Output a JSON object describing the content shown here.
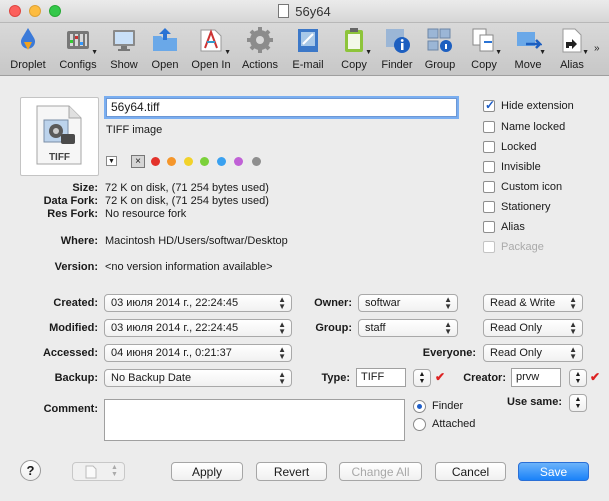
{
  "window": {
    "title": "56y64"
  },
  "toolbar": {
    "items": [
      {
        "label": "Droplet",
        "icon": "droplet-icon"
      },
      {
        "label": "Configs",
        "icon": "configs-icon"
      },
      {
        "label": "Show",
        "icon": "show-icon"
      },
      {
        "label": "Open",
        "icon": "open-icon"
      },
      {
        "label": "Open In",
        "icon": "open-in-icon"
      },
      {
        "label": "Actions",
        "icon": "gear-icon"
      },
      {
        "label": "E-mail",
        "icon": "email-icon"
      },
      {
        "label": "Copy",
        "icon": "clipboard-icon"
      },
      {
        "label": "Finder",
        "icon": "finder-info-icon"
      },
      {
        "label": "Group",
        "icon": "group-icon"
      },
      {
        "label": "Copy",
        "icon": "copy-files-icon"
      },
      {
        "label": "Move",
        "icon": "move-icon"
      },
      {
        "label": "Alias",
        "icon": "alias-icon"
      }
    ]
  },
  "file": {
    "name": "56y64.tiff",
    "kind": "TIFF image",
    "icon_label": "TIFF"
  },
  "labels": {
    "colors": [
      "#e3322b",
      "#f5962a",
      "#f2d22a",
      "#7bd13a",
      "#3aa1f0",
      "#c061d6",
      "#8f8f8f"
    ]
  },
  "info": {
    "size_label": "Size:",
    "size_value": "72 K on disk, (71 254 bytes used)",
    "datafork_label": "Data Fork:",
    "datafork_value": "72 K on disk, (71 254 bytes used)",
    "resfork_label": "Res Fork:",
    "resfork_value": "No resource fork",
    "where_label": "Where:",
    "where_value": "Macintosh HD/Users/softwar/Desktop",
    "version_label": "Version:",
    "version_value": "<no version information available>"
  },
  "options": {
    "hide_extension": {
      "label": "Hide extension",
      "checked": true
    },
    "name_locked": {
      "label": "Name locked",
      "checked": false
    },
    "locked": {
      "label": "Locked",
      "checked": false
    },
    "invisible": {
      "label": "Invisible",
      "checked": false
    },
    "custom_icon": {
      "label": "Custom icon",
      "checked": false
    },
    "stationery": {
      "label": "Stationery",
      "checked": false
    },
    "alias": {
      "label": "Alias",
      "checked": false
    },
    "package": {
      "label": "Package",
      "checked": false
    }
  },
  "dates": {
    "created_label": "Created:",
    "created_value": "03 июля 2014 г., 22:24:45",
    "modified_label": "Modified:",
    "modified_value": "03 июля 2014 г., 22:24:45",
    "accessed_label": "Accessed:",
    "accessed_value": "04 июня 2014 г., 0:21:37",
    "backup_label": "Backup:",
    "backup_value": "No Backup Date"
  },
  "perms": {
    "owner_label": "Owner:",
    "owner_value": "softwar",
    "owner_perm": "Read & Write",
    "group_label": "Group:",
    "group_value": "staff",
    "group_perm": "Read Only",
    "everyone_label": "Everyone:",
    "everyone_perm": "Read Only"
  },
  "type_creator": {
    "type_label": "Type:",
    "type_value": "TIFF",
    "creator_label": "Creator:",
    "creator_value": "prvw"
  },
  "comment": {
    "label": "Comment:",
    "value": ""
  },
  "storage": {
    "finder_label": "Finder",
    "attached_label": "Attached",
    "use_same_label": "Use same:"
  },
  "buttons": {
    "help": "?",
    "apply": "Apply",
    "revert": "Revert",
    "change_all": "Change All",
    "cancel": "Cancel",
    "save": "Save"
  }
}
